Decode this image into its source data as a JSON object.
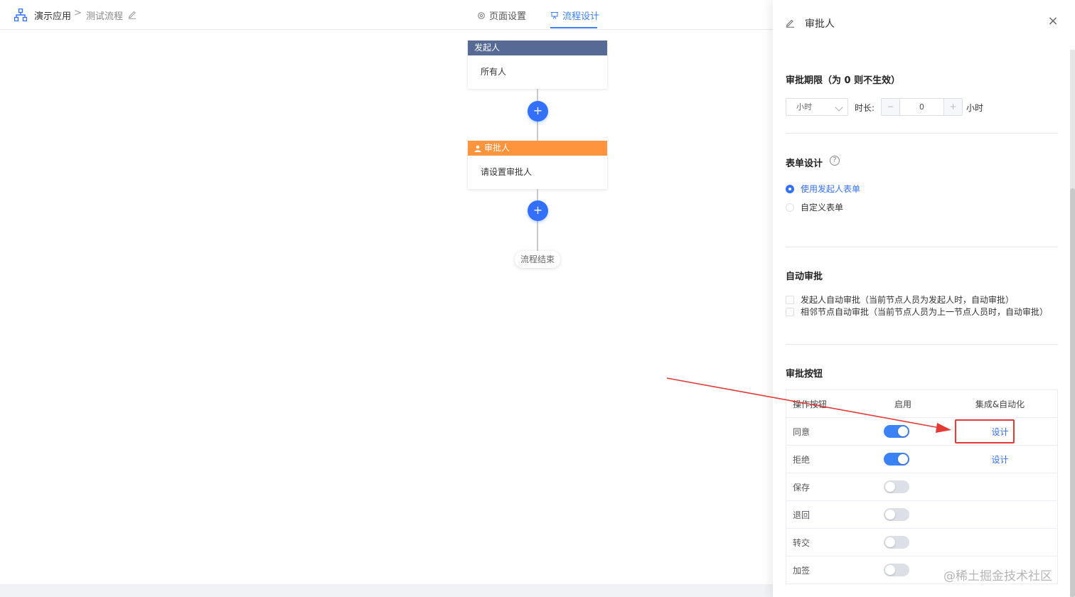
{
  "header": {
    "app_name": "演示应用",
    "separator": ">",
    "flow_name": "测试流程",
    "tabs": [
      {
        "label": "页面设置",
        "active": false
      },
      {
        "label": "流程设计",
        "active": true
      }
    ]
  },
  "canvas": {
    "start_node": {
      "title": "发起人",
      "content": "所有人"
    },
    "approver_node": {
      "title": "审批人",
      "content": "请设置审批人"
    },
    "add_symbol": "+",
    "end_label": "流程结束"
  },
  "drawer": {
    "title": "审批人",
    "close_symbol": "×",
    "deadline": {
      "title": "审批期限（为 0 则不生效）",
      "unit_select": "小时",
      "duration_label": "时长:",
      "minus": "−",
      "value": "0",
      "plus": "+",
      "unit_label": "小时"
    },
    "form_design": {
      "title": "表单设计",
      "help": "?",
      "options": [
        {
          "label": "使用发起人表单",
          "selected": true
        },
        {
          "label": "自定义表单",
          "selected": false
        }
      ]
    },
    "auto_approve": {
      "title": "自动审批",
      "options": [
        {
          "label": "发起人自动审批（当前节点人员为发起人时，自动审批）",
          "checked": false
        },
        {
          "label": "相邻节点自动审批（当前节点人员为上一节点人员时，自动审批）",
          "checked": false
        }
      ]
    },
    "buttons": {
      "title": "审批按钮",
      "columns": [
        "操作按钮",
        "启用",
        "集成&自动化"
      ],
      "rows": [
        {
          "name": "同意",
          "enabled": true,
          "action": "设计"
        },
        {
          "name": "拒绝",
          "enabled": true,
          "action": "设计"
        },
        {
          "name": "保存",
          "enabled": false,
          "action": ""
        },
        {
          "name": "退回",
          "enabled": false,
          "action": ""
        },
        {
          "name": "转交",
          "enabled": false,
          "action": ""
        },
        {
          "name": "加签",
          "enabled": false,
          "action": ""
        }
      ]
    }
  },
  "watermark": "@稀土掘金技术社区",
  "colors": {
    "primary": "#3370ff",
    "start_node_header": "#576a95",
    "approver_node_header": "#ff943e",
    "annotation": "#e53935"
  }
}
